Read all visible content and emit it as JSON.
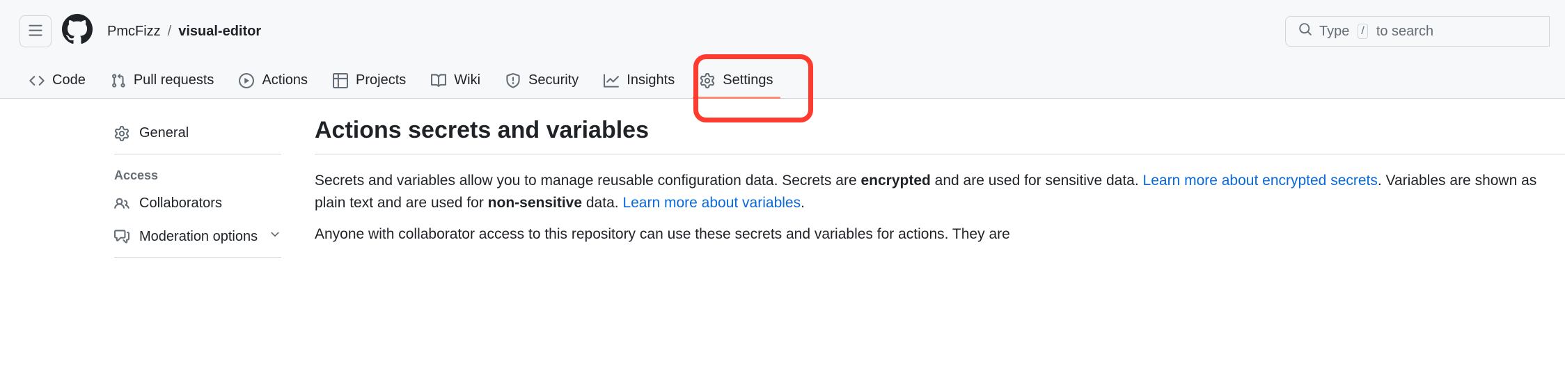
{
  "header": {
    "owner": "PmcFizz",
    "separator": "/",
    "repo": "visual-editor",
    "search": {
      "pre": "Type ",
      "key": "/",
      "post": " to search"
    }
  },
  "nav": {
    "code": "Code",
    "pulls": "Pull requests",
    "actions": "Actions",
    "projects": "Projects",
    "wiki": "Wiki",
    "security": "Security",
    "insights": "Insights",
    "settings": "Settings"
  },
  "sidebar": {
    "general": "General",
    "access_section": "Access",
    "collaborators": "Collaborators",
    "moderation": "Moderation options"
  },
  "content": {
    "title": "Actions secrets and variables",
    "p1a": "Secrets and variables allow you to manage reusable configuration data. Secrets are ",
    "p1b": "encrypted",
    "p1c": " and are used for sensitive data. ",
    "link1": "Learn more about encrypted secrets",
    "p1d": ". Variables are shown as plain text and are used for ",
    "p1e": "non-sensitive",
    "p1f": " data. ",
    "link2": "Learn more about variables",
    "p1g": ".",
    "p2": "Anyone with collaborator access to this repository can use these secrets and variables for actions. They are"
  }
}
